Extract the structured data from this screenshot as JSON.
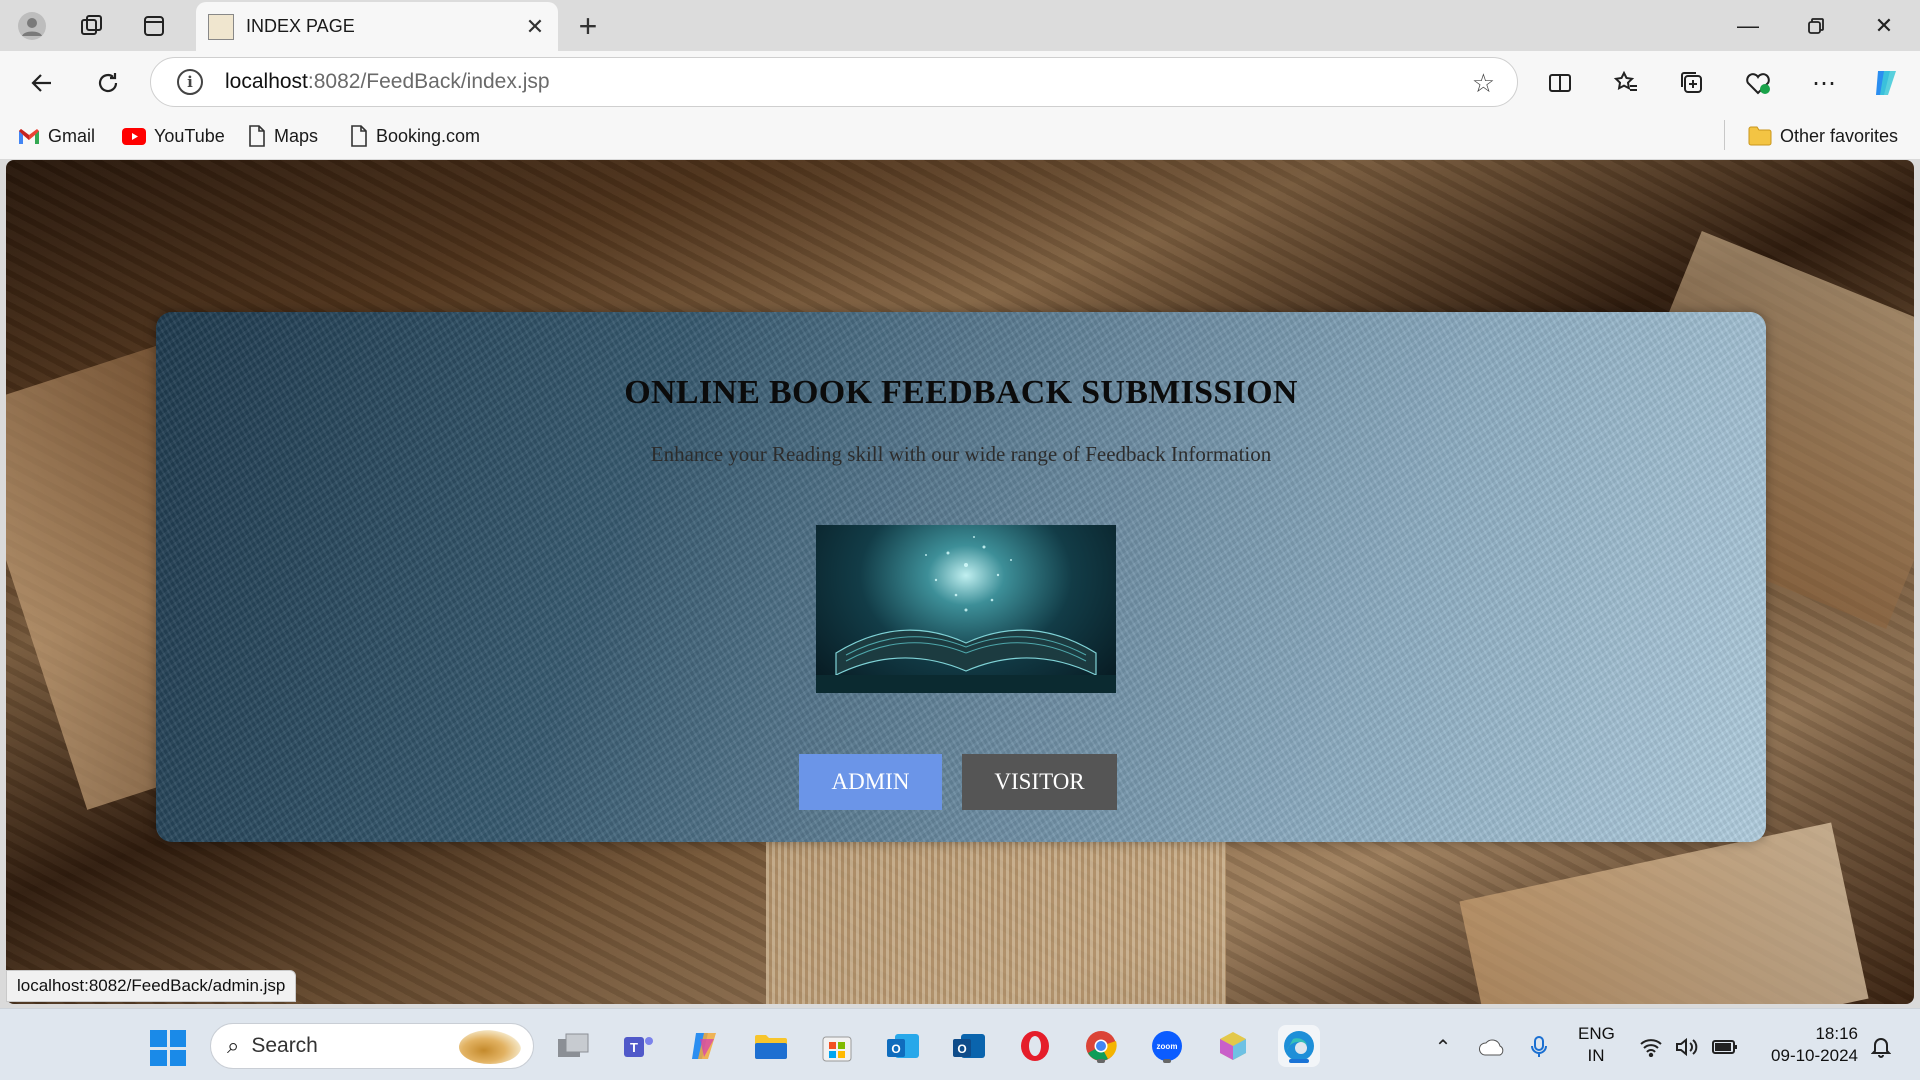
{
  "browser": {
    "tab": {
      "title": "INDEX PAGE"
    },
    "address": {
      "host": "localhost",
      "path": ":8082/FeedBack/index.jsp"
    },
    "bookmarks": [
      {
        "label": "Gmail",
        "icon": "gmail-icon"
      },
      {
        "label": "YouTube",
        "icon": "youtube-icon"
      },
      {
        "label": "Maps",
        "icon": "page-icon"
      },
      {
        "label": "Booking.com",
        "icon": "page-icon"
      }
    ],
    "other_favorites": "Other favorites",
    "status_url": "localhost:8082/FeedBack/admin.jsp"
  },
  "page": {
    "heading": "ONLINE BOOK FEEDBACK SUBMISSION",
    "tagline": "Enhance your Reading skill with our wide range of Feedback Information",
    "admin_button": "ADMIN",
    "visitor_button": "VISITOR",
    "colors": {
      "admin": "#6b95e8",
      "visitor": "#555555"
    }
  },
  "taskbar": {
    "search_placeholder": "Search",
    "lang_line1": "ENG",
    "lang_line2": "IN",
    "time": "18:16",
    "date": "09-10-2024",
    "apps": [
      "task-view",
      "teams",
      "copilot",
      "file-explorer",
      "microsoft-store",
      "outlook-new",
      "outlook",
      "opera",
      "chrome",
      "zoom",
      "app-box",
      "edge"
    ]
  }
}
